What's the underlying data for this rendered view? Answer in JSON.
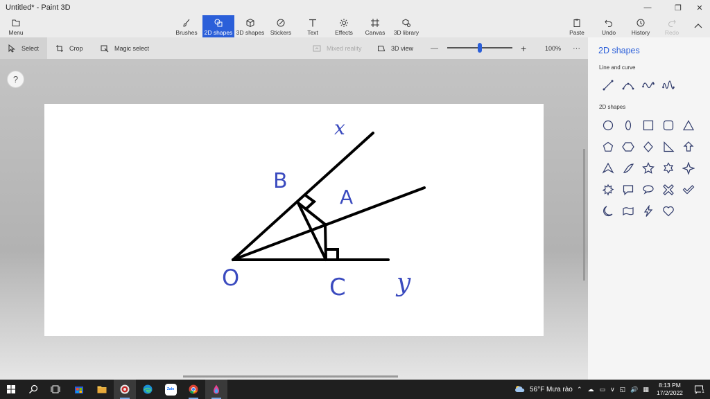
{
  "window": {
    "title": "Untitled* - Paint 3D",
    "controls": [
      "minimize",
      "restore",
      "close"
    ]
  },
  "ribbon": {
    "menu_label": "Menu",
    "tools": [
      {
        "label": "Brushes",
        "icon": "brush-icon"
      },
      {
        "label": "2D shapes",
        "icon": "2d-shapes-icon",
        "active": true
      },
      {
        "label": "3D shapes",
        "icon": "cube-icon"
      },
      {
        "label": "Stickers",
        "icon": "sticker-icon"
      },
      {
        "label": "Text",
        "icon": "text-icon"
      },
      {
        "label": "Effects",
        "icon": "sun-icon"
      },
      {
        "label": "Canvas",
        "icon": "canvas-icon"
      },
      {
        "label": "3D library",
        "icon": "3d-library-icon"
      }
    ],
    "right": [
      {
        "label": "Paste",
        "icon": "paste-icon"
      },
      {
        "label": "Undo",
        "icon": "undo-icon"
      },
      {
        "label": "History",
        "icon": "history-icon"
      },
      {
        "label": "Redo",
        "icon": "redo-icon",
        "disabled": true
      }
    ]
  },
  "options_bar": {
    "select": "Select",
    "crop": "Crop",
    "magic_select": "Magic select",
    "mixed_reality": "Mixed reality",
    "view_3d": "3D view",
    "zoom_minus": "—",
    "zoom_plus": "+",
    "zoom_level": "100%",
    "zoom_fraction": 0.5,
    "more": "···"
  },
  "help": "?",
  "drawing": {
    "labels": {
      "x": "x",
      "B": "B",
      "A": "A",
      "O": "O",
      "C": "C",
      "y": "y"
    },
    "ink_color": "#3b4bbf"
  },
  "side_panel": {
    "title": "2D shapes",
    "section_line": "Line and curve",
    "section_shapes": "2D shapes",
    "line_tools": [
      "line-icon",
      "curve-icon",
      "wave-icon",
      "zigzag-curve-icon"
    ],
    "shape_tools": [
      "circle-icon",
      "ellipse-icon",
      "square-icon",
      "rounded-square-icon",
      "triangle-icon",
      "pentagon-icon",
      "hexagon-icon",
      "diamond-icon",
      "right-triangle-icon",
      "arrow-up-icon",
      "arrowhead-icon",
      "quarter-circle-icon",
      "star-5-icon",
      "star-6-icon",
      "star-4-icon",
      "burst-icon",
      "speech-bubble-icon",
      "thought-bubble-icon",
      "x-mark-icon",
      "check-mark-icon",
      "crescent-icon",
      "wave-banner-icon",
      "lightning-icon",
      "heart-icon"
    ]
  },
  "taskbar": {
    "apps": [
      "windows-icon",
      "search-icon",
      "task-view-icon",
      "store-icon",
      "file-explorer-icon",
      "obs-icon",
      "edge-icon",
      "zalo-icon",
      "chrome-icon",
      "paint3d-icon"
    ],
    "zalo_text": "Zalo",
    "weather": "56°F  Mưa rào",
    "time": "8:13 PM",
    "date": "17/2/2022",
    "notifications": "1"
  },
  "colors": {
    "accent": "#2b5fd9",
    "ink": "#3b4bbf"
  }
}
